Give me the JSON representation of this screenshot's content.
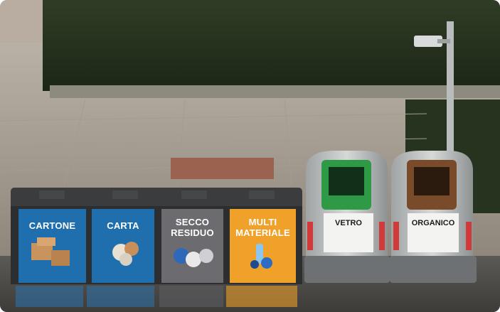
{
  "bins": [
    {
      "label": "CARTONE",
      "color": "#1f6fae"
    },
    {
      "label": "CARTA",
      "color": "#1f6fae"
    },
    {
      "label": "SECCO RESIDUO",
      "color": "#6c6c70"
    },
    {
      "label": "MULTI MATERIALE",
      "color": "#f0a12a"
    }
  ],
  "containers": [
    {
      "label": "VETRO",
      "accent": "#2e9a45"
    },
    {
      "label": "ORGANICO",
      "accent": "#7a4b2a"
    }
  ]
}
